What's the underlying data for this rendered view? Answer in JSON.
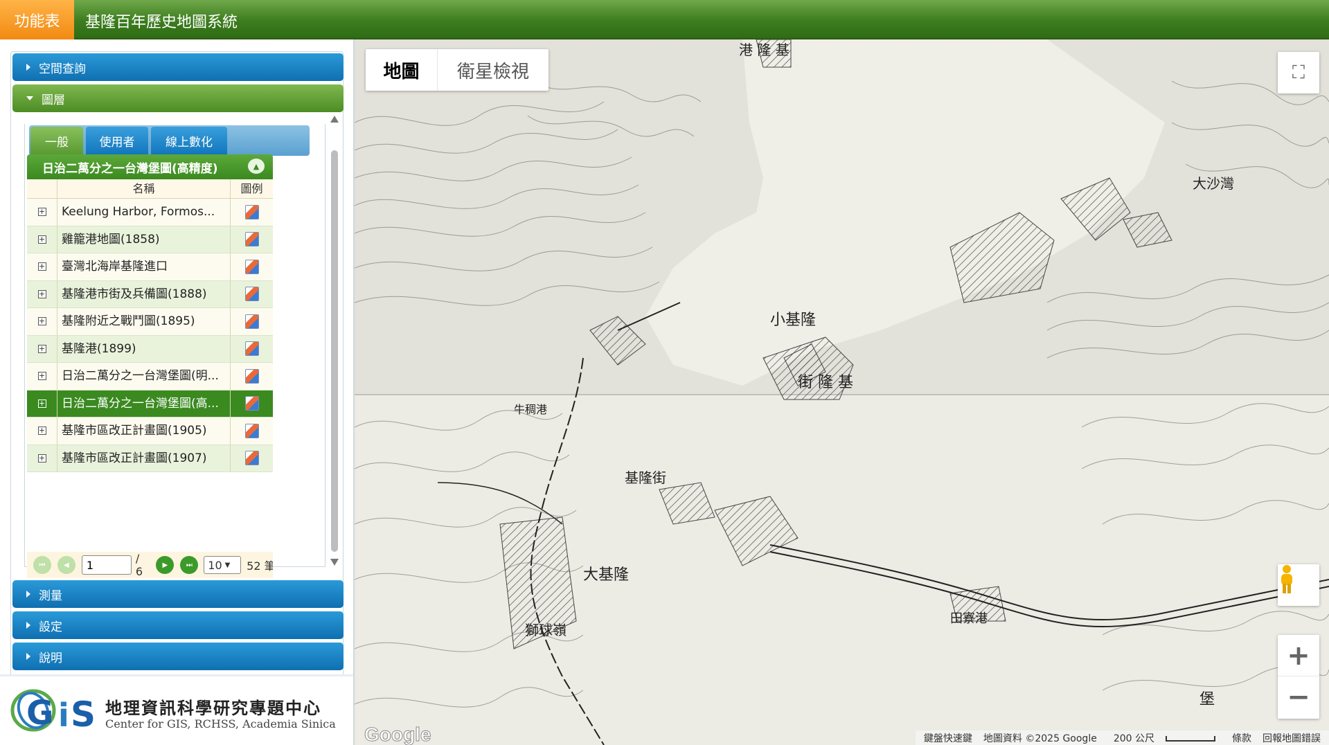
{
  "header": {
    "menu_label": "功能表",
    "title": "基隆百年歷史地圖系統"
  },
  "sidebar": {
    "sections": {
      "spatial_query": "空間查詢",
      "layers": "圖層",
      "measure": "測量",
      "settings": "設定",
      "help": "說明"
    },
    "tabs": [
      "一般",
      "使用者",
      "線上數化"
    ],
    "grid": {
      "title": "日治二萬分之一台灣堡圖(高精度)",
      "col_name": "名稱",
      "col_legend": "圖例",
      "rows": [
        "Keelung Harbor, Formos...",
        "雞籠港地圖(1858)",
        "臺灣北海岸基隆進口",
        "基隆港市街及兵備圖(1888)",
        "基隆附近之戰鬥圖(1895)",
        "基隆港(1899)",
        "日治二萬分之一台灣堡圖(明...",
        "日治二萬分之一台灣堡圖(高...",
        "基隆市區改正計畫圖(1905)",
        "基隆市區改正計畫圖(1907)"
      ],
      "selected_index": 7
    },
    "pager": {
      "current_page": "1",
      "total_pages": "/ 6",
      "page_size": "10",
      "total_count": "52 筆"
    }
  },
  "logo": {
    "abbr": "GiS",
    "name_cn": "地理資訊科學研究專題中心",
    "name_en": "Center for GIS, RCHSS, Academia Sinica"
  },
  "map": {
    "type_buttons": [
      "地圖",
      "衛星檢視"
    ],
    "active_type": "地圖",
    "attribution": {
      "shortcuts": "鍵盤快速鍵",
      "data": "地圖資料 ©2025 Google",
      "scale": "200 公尺",
      "terms": "條款",
      "report": "回報地圖錯誤"
    },
    "google_label": "Google",
    "map_labels": {
      "top_town": "港 隆 基",
      "small_keelung": "小基隆",
      "street_label": "街 隆 基",
      "pocket_label": "牛稠港",
      "sea_label": "大沙灣",
      "hakka_label": "田寮港",
      "kindergarten": "基隆街",
      "dalong": "大基隆",
      "shiqiu": "獅球嶺",
      "bao": "堡"
    }
  },
  "colors": {
    "accent_green": "#3a8a20",
    "accent_blue": "#1176bd",
    "menu_orange": "#f28a12",
    "map_paper": "#ecebe4"
  }
}
